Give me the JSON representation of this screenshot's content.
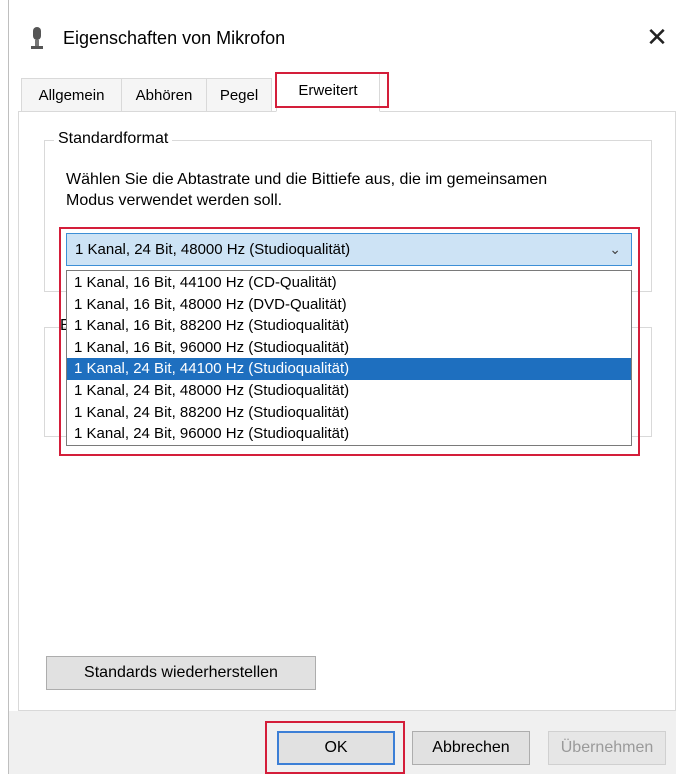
{
  "window": {
    "title": "Eigenschaften von Mikrofon",
    "close_glyph": "✕"
  },
  "tabs": [
    {
      "label": "Allgemein",
      "active": false
    },
    {
      "label": "Abhören",
      "active": false
    },
    {
      "label": "Pegel",
      "active": false
    },
    {
      "label": "Erweitert",
      "active": true
    }
  ],
  "standardformat": {
    "legend": "Standardformat",
    "description": "Wählen Sie die Abtastrate und die Bittiefe aus, die im gemeinsamen Modus verwendet werden soll.",
    "selected_value": "1 Kanal, 24 Bit, 48000 Hz (Studioqualität)",
    "options": [
      "1 Kanal, 16 Bit, 44100 Hz (CD-Qualität)",
      "1 Kanal, 16 Bit, 48000 Hz (DVD-Qualität)",
      "1 Kanal, 16 Bit, 88200 Hz (Studioqualität)",
      "1 Kanal, 16 Bit, 96000 Hz (Studioqualität)",
      "1 Kanal, 24 Bit, 44100 Hz (Studioqualität)",
      "1 Kanal, 24 Bit, 48000 Hz (Studioqualität)",
      "1 Kanal, 24 Bit, 88200 Hz (Studioqualität)",
      "1 Kanal, 24 Bit, 96000 Hz (Studioqualität)"
    ],
    "highlighted_option": "1 Kanal, 24 Bit, 44100 Hz (Studioqualität)"
  },
  "second_group_label_fragment": "E",
  "buttons": {
    "restore_defaults": "Standards wiederherstellen",
    "ok": "OK",
    "cancel": "Abbrechen",
    "apply": "Übernehmen"
  },
  "icons": {
    "title": "microphone-icon",
    "dropdown": "chevron-down-icon"
  },
  "colors": {
    "highlight_box": "#d41e3a",
    "selection": "#1e6fbf",
    "combobox_fill": "#cde3f5"
  }
}
